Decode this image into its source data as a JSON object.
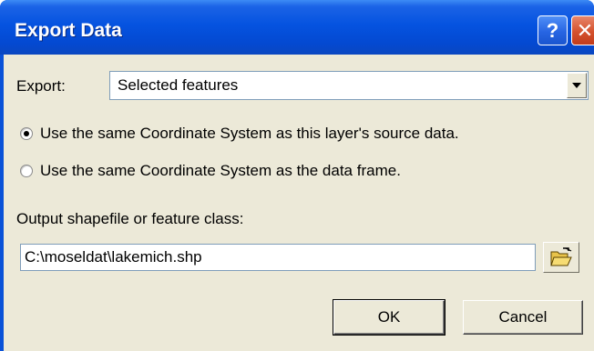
{
  "window": {
    "title": "Export Data",
    "help_label": "?",
    "close_label": "✕"
  },
  "export": {
    "label": "Export:",
    "selected": "Selected features"
  },
  "coordinate_options": [
    {
      "label": "Use the same Coordinate System as this layer's source data.",
      "selected": true
    },
    {
      "label": "Use the same Coordinate System as the data frame.",
      "selected": false
    }
  ],
  "output": {
    "label": "Output shapefile or feature class:",
    "value": "C:\\moseldat\\lakemich.shp"
  },
  "buttons": {
    "ok": "OK",
    "cancel": "Cancel"
  },
  "icons": {
    "browse": "open-folder-icon",
    "dropdown": "chevron-down-icon"
  }
}
